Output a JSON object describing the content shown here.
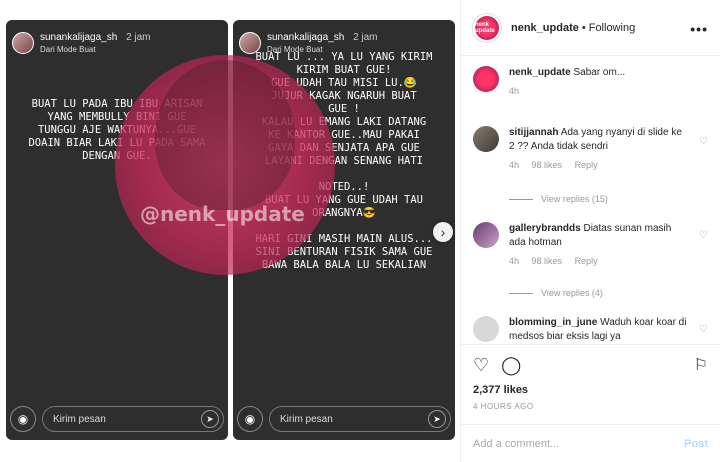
{
  "stories": [
    {
      "username": "sunankalijaga_sh",
      "time": "2 jam",
      "subtitle": "Dari Mode Buat",
      "text": "BUAT LU PADA IBU IBU ARISAN\nYANG MEMBULLY BINI GUE\nTUNGGU AJE WAKTUNYA...GUE\nDOAIN BIAR LAKI LU PADA SAMA\nDENGAN GUE.",
      "reply_placeholder": "Kirim pesan",
      "watermark": "@nenk_update"
    },
    {
      "username": "sunankalijaga_sh",
      "time": "2 jam",
      "subtitle": "Dari Mode Buat",
      "text": "BUAT LU ... YA LU YANG KIRIM\nKIRIM BUAT GUE!\nGUE UDAH TAU MISI LU.😂\nJUJUR KAGAK NGARUH BUAT\nGUE !\nKALAU LU EMANG LAKI DATANG\nKE KANTOR GUE..MAU PAKAI\nGAYA DAN SENJATA APA GUE\nLAYANI DENGAN SENANG HATI\n\nNOTED..!\nBUAT LU YANG GUE UDAH TAU\nORANGNYA😎\n\nHARI GINI MASIH MAIN ALUS...\nSINI BENTURAN FISIK SAMA GUE\nBAWA BALA BALA LU SEKALIAN",
      "reply_placeholder": "Kirim pesan"
    }
  ],
  "header": {
    "username": "nenk_update",
    "separator": "•",
    "follow_status": "Following",
    "avatar_text": "nenk update"
  },
  "caption": {
    "username": "nenk_update",
    "text": "Sabar om...",
    "time": "4h"
  },
  "comments": [
    {
      "username": "sitijjannah",
      "text": "Ada yang nyanyi di slide ke 2 ?? Anda tidak sendri",
      "time": "4h",
      "likes": "98 likes",
      "reply": "Reply",
      "view_replies": "View replies (15)"
    },
    {
      "username": "gallerybrandds",
      "text": "Diatas sunan masih ada hotman",
      "time": "4h",
      "likes": "98 likes",
      "reply": "Reply",
      "view_replies": "View replies (4)"
    },
    {
      "username": "blomming_in_june",
      "text": "Waduh koar koar di medsos biar eksis lagi ya"
    }
  ],
  "post": {
    "likes": "2,377 likes",
    "time": "4 HOURS AGO",
    "add_comment_placeholder": "Add a comment...",
    "post_label": "Post"
  },
  "colors": {
    "story_bg": "#2e2e2e",
    "watermark": "#e1406e",
    "post_button": "#b3dbff"
  }
}
